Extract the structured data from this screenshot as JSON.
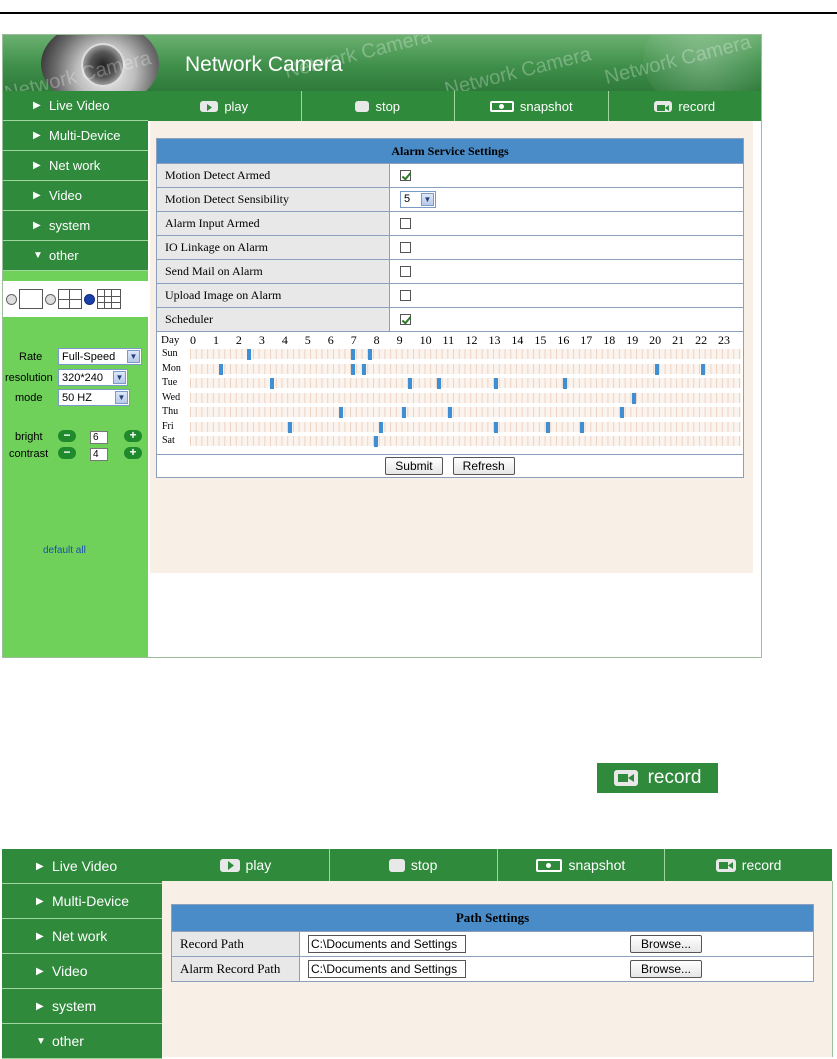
{
  "banner": {
    "title": "Network Camera",
    "watermark": "Network Camera"
  },
  "nav": {
    "items": [
      {
        "label": "Live Video",
        "icon": "triangle-right-icon"
      },
      {
        "label": "Multi-Device",
        "icon": "triangle-right-icon"
      },
      {
        "label": "Net work",
        "icon": "triangle-right-icon"
      },
      {
        "label": "Video",
        "icon": "triangle-right-icon"
      },
      {
        "label": "system",
        "icon": "triangle-right-icon"
      },
      {
        "label": "other",
        "icon": "triangle-down-icon"
      }
    ]
  },
  "toolbar": {
    "play": "play",
    "stop": "stop",
    "snapshot": "snapshot",
    "record": "record"
  },
  "controls": {
    "rate_label": "Rate",
    "rate_value": "Full-Speed",
    "resolution_label": "resolution",
    "resolution_value": "320*240",
    "mode_label": "mode",
    "mode_value": "50 HZ",
    "bright_label": "bright",
    "bright_value": "6",
    "contrast_label": "contrast",
    "contrast_value": "4",
    "default_all": "default all"
  },
  "alarm": {
    "title": "Alarm Service Settings",
    "rows": [
      {
        "label": "Motion Detect Armed",
        "checked": true
      },
      {
        "label": "Motion Detect Sensibility",
        "select": "5"
      },
      {
        "label": "Alarm Input Armed",
        "checked": false
      },
      {
        "label": "IO Linkage on Alarm",
        "checked": false
      },
      {
        "label": "Send Mail on Alarm",
        "checked": false
      },
      {
        "label": "Upload Image on Alarm",
        "checked": false
      },
      {
        "label": "Scheduler",
        "checked": true
      }
    ],
    "schedule_day_label": "Day",
    "hours": [
      "0",
      "1",
      "2",
      "3",
      "4",
      "5",
      "6",
      "7",
      "8",
      "9",
      "10",
      "11",
      "12",
      "13",
      "14",
      "15",
      "16",
      "17",
      "18",
      "19",
      "20",
      "21",
      "22",
      "23"
    ],
    "days": [
      "Sun",
      "Mon",
      "Tue",
      "Wed",
      "Thu",
      "Fri",
      "Sat"
    ],
    "selected_slots": {
      "Sun": [
        2.5,
        7.0,
        7.75
      ],
      "Mon": [
        1.25,
        7.0,
        7.5,
        20.25,
        22.25
      ],
      "Tue": [
        3.5,
        9.5,
        10.75,
        13.25,
        16.25
      ],
      "Wed": [
        19.25
      ],
      "Thu": [
        6.5,
        9.25,
        11.25,
        18.75
      ],
      "Fri": [
        4.25,
        8.25,
        13.25,
        15.5,
        17.0
      ],
      "Sat": [
        8.0
      ]
    },
    "submit": "Submit",
    "refresh": "Refresh"
  },
  "record_button": {
    "label": "record"
  },
  "path": {
    "title": "Path Settings",
    "rows": [
      {
        "label": "Record Path",
        "value": "C:\\Documents and Settings",
        "browse": "Browse..."
      },
      {
        "label": "Alarm Record Path",
        "value": "C:\\Documents and Settings",
        "browse": "Browse..."
      }
    ]
  },
  "colors": {
    "nav_green": "#2f8a3c",
    "side_green": "#6fd05a",
    "table_header_blue": "#4a8cc8",
    "content_bg": "#f8efe6",
    "slot_blue": "#3f8fd2"
  }
}
